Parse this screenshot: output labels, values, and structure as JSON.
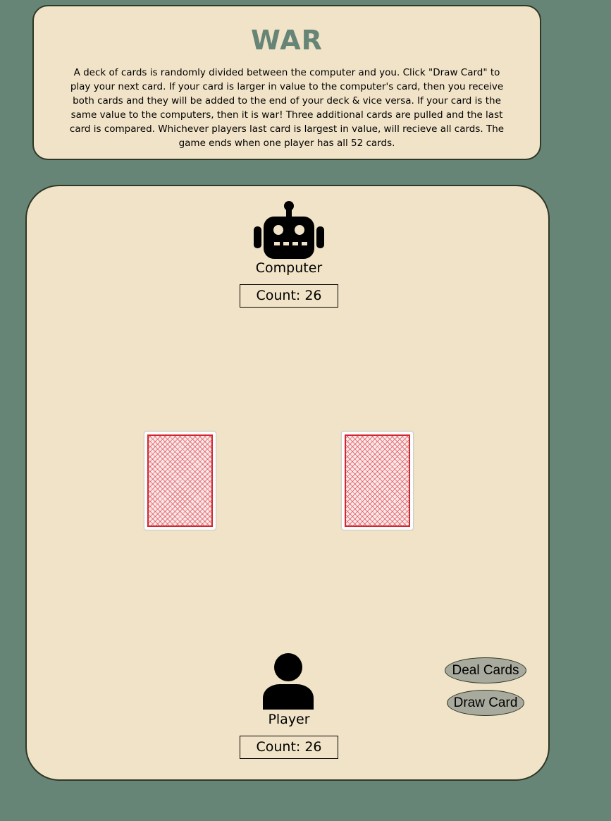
{
  "header": {
    "title": "WAR",
    "rules": "A deck of cards is randomly divided between the computer and you. Click \"Draw Card\" to play your next card. If your card is larger in value to the computer's card, then you receive both cards and they will be added to the end of your deck & vice versa. If your card is the same value to the computers, then it is war! Three additional cards are pulled and the last card is compared. Whichever players last card is largest in value, will recieve all cards. The game ends when one player has all 52 cards."
  },
  "computer": {
    "icon": "robot-icon",
    "name": "Computer",
    "count_label": "Count: 26"
  },
  "player": {
    "icon": "user-icon",
    "name": "Player",
    "count_label": "Count: 26"
  },
  "table": {
    "cards": [
      {
        "face": "card-back"
      },
      {
        "face": "card-back"
      }
    ]
  },
  "controls": {
    "deal_label": "Deal Cards",
    "draw_label": "Draw Card"
  },
  "colors": {
    "background": "#678577",
    "panel": "#f1e3c7",
    "title": "#678577",
    "card_back": "#d4262e",
    "button": "#a8aa9e"
  }
}
